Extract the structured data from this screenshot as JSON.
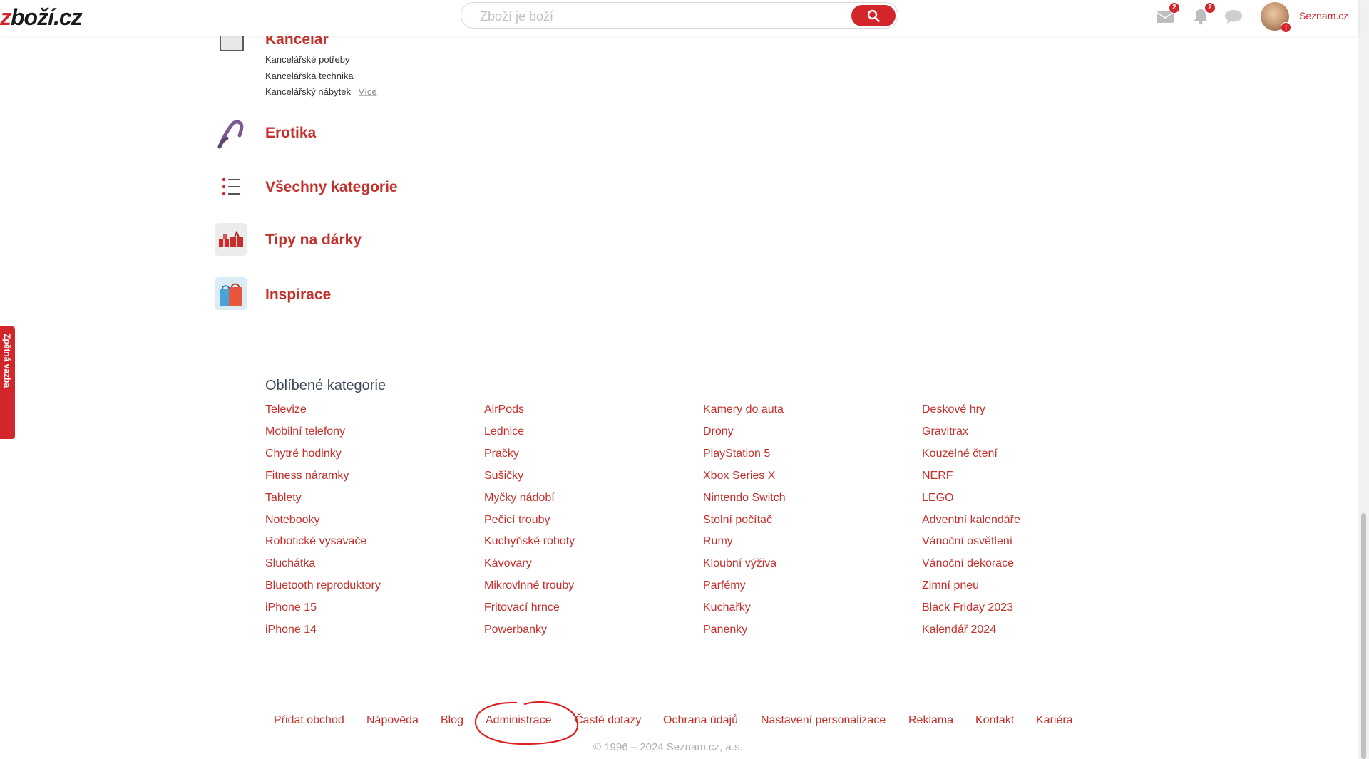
{
  "header": {
    "logo_text": "zboží.cz",
    "search_placeholder": "Zboží je boží",
    "mail_badge": "2",
    "notif_badge": "2",
    "avatar_alert": "!",
    "seznam_label": "Seznam.cz"
  },
  "categories": [
    {
      "title": "Kancelář",
      "subitems": [
        "Kancelářské potřeby",
        "Kancelářská technika",
        "Kancelářský nábytek"
      ],
      "more_label": "Více"
    },
    {
      "title": "Erotika"
    },
    {
      "title": "Všechny kategorie"
    },
    {
      "title": "Tipy na dárky"
    },
    {
      "title": "Inspirace"
    }
  ],
  "popular": {
    "title": "Oblíbené kategorie",
    "columns": [
      [
        "Televize",
        "Mobilní telefony",
        "Chytré hodinky",
        "Fitness náramky",
        "Tablety",
        "Notebooky",
        "Robotické vysavače",
        "Sluchátka",
        "Bluetooth reproduktory",
        "iPhone 15",
        "iPhone 14"
      ],
      [
        "AirPods",
        "Lednice",
        "Pračky",
        "Sušičky",
        "Myčky nádobí",
        "Pečicí trouby",
        "Kuchyňské roboty",
        "Kávovary",
        "Mikrovlnné trouby",
        "Fritovací hrnce",
        "Powerbanky"
      ],
      [
        "Kamery do auta",
        "Drony",
        "PlayStation 5",
        "Xbox Series X",
        "Nintendo Switch",
        "Stolní počítač",
        "Rumy",
        "Kloubní výživa",
        "Parfémy",
        "Kuchařky",
        "Panenky"
      ],
      [
        "Deskové hry",
        "Gravitrax",
        "Kouzelné čtení",
        "NERF",
        "LEGO",
        "Adventní kalendáře",
        "Vánoční osvětlení",
        "Vánoční dekorace",
        "Zimní pneu",
        "Black Friday 2023",
        "Kalendář 2024"
      ]
    ]
  },
  "footer": {
    "links": [
      "Přidat obchod",
      "Nápověda",
      "Blog",
      "Administrace",
      "Časté dotazy",
      "Ochrana údajů",
      "Nastavení personalizace",
      "Reklama",
      "Kontakt",
      "Kariéra"
    ],
    "copyright": "© 1996 – 2024 Seznam.cz, a.s."
  },
  "side_tab": {
    "label": "Zpětná vazba"
  },
  "colors": {
    "accent": "#c4302b",
    "brand_red": "#d3262b"
  }
}
